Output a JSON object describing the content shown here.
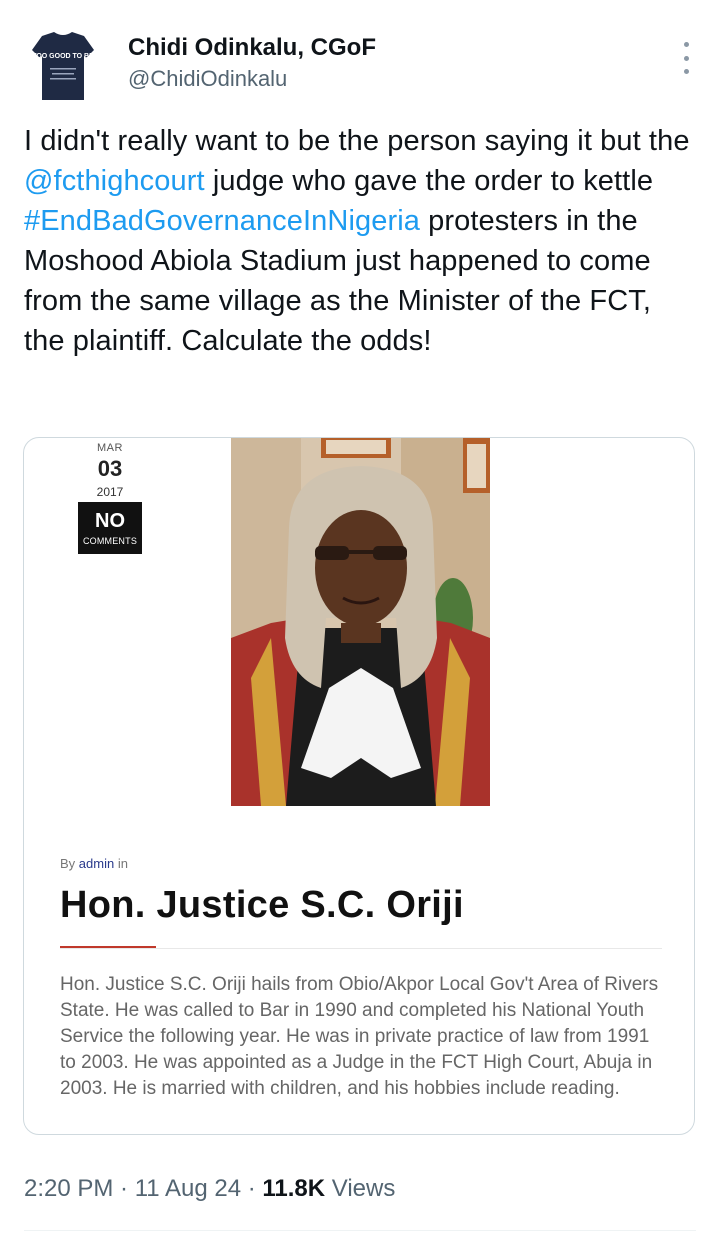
{
  "tweet": {
    "author_name": "Chidi Odinkalu, CGoF",
    "author_handle": "@ChidiOdinkalu",
    "avatar_shirt_text": "TOO GOOD TO BE",
    "text_parts": {
      "p1": "I didn't really want to be the person saying it but the ",
      "mention": "@fcthighcourt",
      "p2": " judge who gave the order to kettle ",
      "hashtag": "#EndBadGovernanceInNigeria",
      "p3": " protesters in the Moshood Abiola Stadium just happened to come from the same village as the Minister of the FCT, the plaintiff. Calculate the odds!"
    },
    "time": "2:20 PM",
    "date": "11 Aug 24",
    "views_count": "11.8K",
    "views_label": "Views",
    "separator": " · "
  },
  "card": {
    "date_month": "MAR",
    "date_day": "03",
    "date_year": "2017",
    "comments_count": "NO",
    "comments_label": "COMMENTS",
    "by_prefix": "By",
    "by_author": "admin",
    "by_suffix": "in",
    "title": "Hon. Justice S.C. Oriji",
    "body": "Hon. Justice S.C. Oriji hails from Obio/Akpor Local Gov't Area of Rivers State. He was called to Bar in 1990 and completed his National Youth Service the following year. He was in private practice of law from 1991 to 2003. He was appointed as a Judge in the FCT High Court, Abuja in 2003. He is married with children, and his hobbies include reading."
  },
  "colors": {
    "link": "#1d9bf0",
    "secondary_text": "#536471",
    "title_accent": "#c0392b"
  }
}
